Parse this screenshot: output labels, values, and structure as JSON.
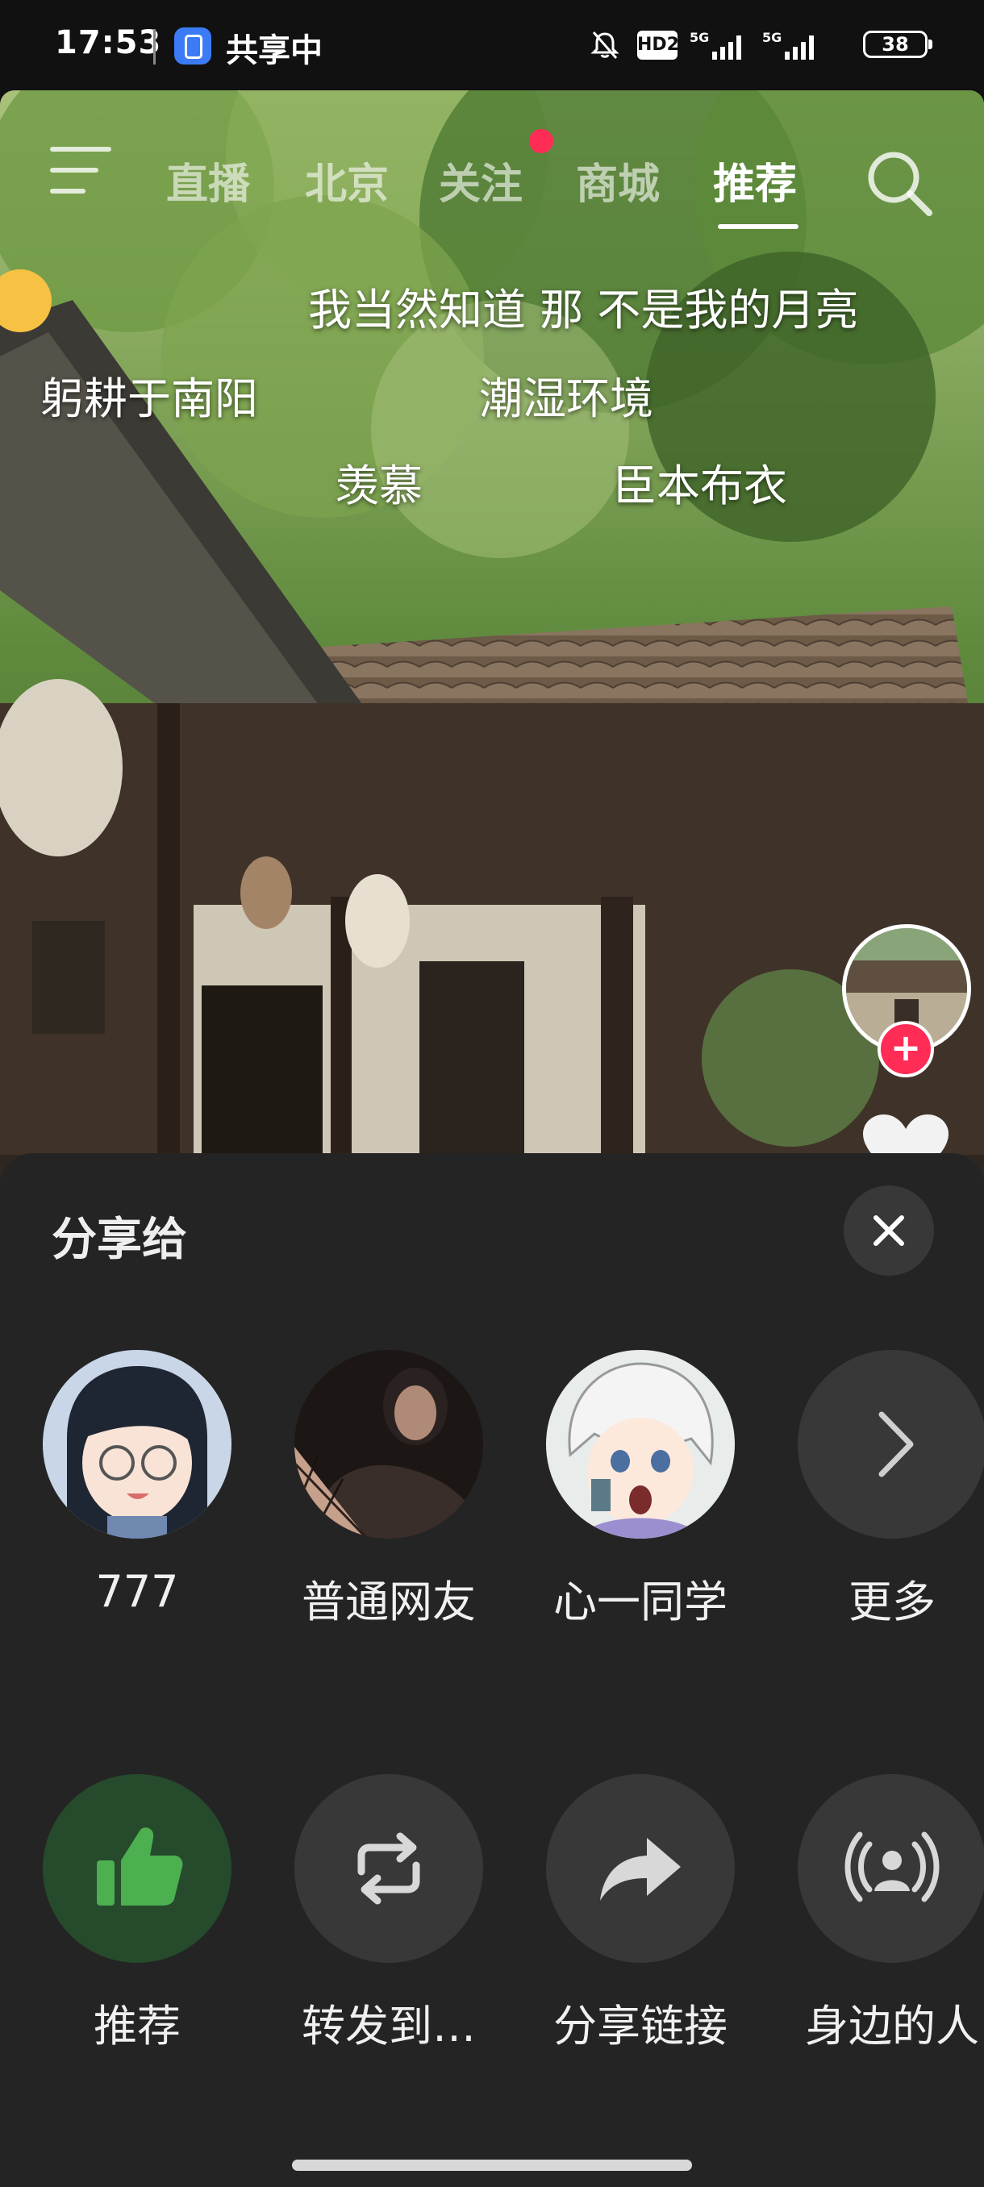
{
  "status_bar": {
    "time": "17:53",
    "sharing_label": "共享中",
    "hd_label": "HD2",
    "signal_1": "5G",
    "signal_2": "5G",
    "battery": "38"
  },
  "top_nav": {
    "tabs": [
      "直播",
      "北京",
      "关注",
      "商城",
      "推荐"
    ],
    "active_tab": "推荐",
    "follow_has_dot": true
  },
  "danmaku": [
    "我当然知道 那 不是我的月亮",
    "躬耕于南阳",
    "潮湿环境",
    "羡慕",
    "臣本布衣"
  ],
  "share_sheet": {
    "title": "分享给",
    "contacts": [
      {
        "name": "777"
      },
      {
        "name": "普通网友"
      },
      {
        "name": "心一同学"
      },
      {
        "name": "更多"
      }
    ],
    "actions": [
      {
        "label": "推荐",
        "icon": "thumbs-up-icon"
      },
      {
        "label": "转发到…",
        "icon": "repost-icon"
      },
      {
        "label": "分享链接",
        "icon": "share-arrow-icon"
      },
      {
        "label": "身边的人",
        "icon": "broadcast-person-icon"
      }
    ]
  },
  "colors": {
    "accent_red": "#ff2c55",
    "sheet_bg": "#242424",
    "recommend_green": "#4caf50"
  }
}
